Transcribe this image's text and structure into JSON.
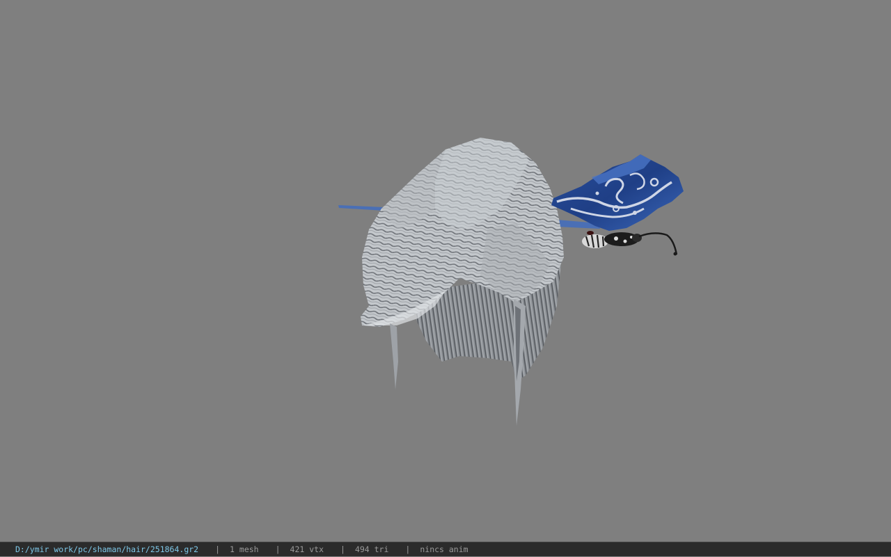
{
  "viewport": {
    "background_color": "#7f7f7f",
    "model": "hair-with-butterfly-ornament"
  },
  "statusbar": {
    "file_path": "D:/ymir work/pc/shaman/hair/251864.gr2",
    "separator": "|",
    "mesh_count": "1 mesh",
    "vertex_count": "421 vtx",
    "triangle_count": "494 tri",
    "anim_status": "nincs anim",
    "path_color": "#7ec8e8",
    "text_color": "#9a9a9a"
  }
}
